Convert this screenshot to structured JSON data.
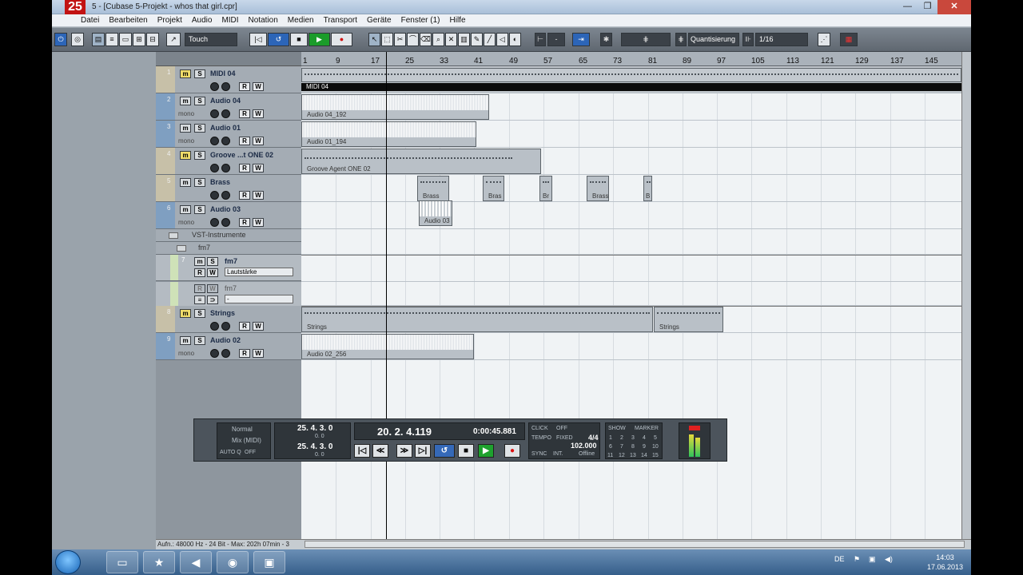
{
  "window": {
    "title": "5 - [Cubase 5-Projekt - whos that girl.cpr]",
    "app_icon_text": "25"
  },
  "menu": [
    "Datei",
    "Bearbeiten",
    "Projekt",
    "Audio",
    "MIDI",
    "Notation",
    "Medien",
    "Transport",
    "Geräte",
    "Fenster (1)",
    "Hilfe"
  ],
  "toolbar": {
    "automation_mode": "Touch",
    "quantize_label": "Quantisierung",
    "quantize_value": "1/16",
    "snap_value": "-"
  },
  "ruler": {
    "ticks": [
      "1",
      "9",
      "17",
      "25",
      "33",
      "41",
      "49",
      "57",
      "65",
      "73",
      "81",
      "89",
      "97",
      "105",
      "113",
      "121",
      "129",
      "137",
      "145"
    ]
  },
  "tracks": [
    {
      "num": "1",
      "name": "MIDI 04",
      "kind": "midi",
      "mono": ""
    },
    {
      "num": "2",
      "name": "Audio 04",
      "kind": "audio",
      "mono": "mono"
    },
    {
      "num": "3",
      "name": "Audio 01",
      "kind": "audio",
      "mono": "mono"
    },
    {
      "num": "4",
      "name": "Groove ...t ONE 02",
      "kind": "midi",
      "mono": ""
    },
    {
      "num": "5",
      "name": "Brass",
      "kind": "midi",
      "mono": ""
    },
    {
      "num": "6",
      "name": "Audio 03",
      "kind": "audio",
      "mono": "mono"
    },
    {
      "num": "8",
      "name": "Strings",
      "kind": "midi",
      "mono": ""
    },
    {
      "num": "9",
      "name": "Audio 02",
      "kind": "audio",
      "mono": "mono"
    }
  ],
  "folders": {
    "vst": "VST-Instrumente",
    "fm7_folder": "fm7"
  },
  "instrument_tracks": [
    {
      "num": "7",
      "name": "fm7",
      "field": "Lautstärke"
    },
    {
      "num": "",
      "name": "fm7",
      "field": "-"
    }
  ],
  "events": {
    "midi04": "MIDI 04",
    "audio04": "Audio 04_192",
    "audio01": "Audio 01_194",
    "groove": "Groove Agent ONE 02",
    "brass1": "Brass",
    "brass2": "Bras",
    "brass3": "Br",
    "brass4": "Brass",
    "brass5": "B",
    "audio03": "Audio 03",
    "strings1": "Strings",
    "strings2": "Strings",
    "audio02": "Audio 02_256"
  },
  "statusbar": "Aufn.: 48000 Hz - 24 Bit - Max: 202h 07min - 3",
  "transport": {
    "sync_mode": "Normal",
    "mix_mode": "Mix (MIDI)",
    "autoq": "AUTO Q",
    "autoq_state": "OFF",
    "left_locator": "25. 4. 3.   0",
    "left_sub": "0.   0",
    "right_locator": "25. 4. 3.   0",
    "right_sub": "0.   0",
    "position": "20.  2.  4.119",
    "time": "0:00:45.881",
    "click_label": "CLICK",
    "click_state": "OFF",
    "tempo_label": "TEMPO",
    "tempo_mode": "FIXED",
    "signature": "4/4",
    "tempo_value": "102.000",
    "sync_label": "SYNC",
    "sync_state": "INT.",
    "offline": "Offline",
    "show_label": "SHOW",
    "marker_label": "MARKER",
    "markers": [
      "1",
      "2",
      "3",
      "4",
      "5",
      "6",
      "7",
      "8",
      "9",
      "10",
      "11",
      "12",
      "13",
      "14",
      "15"
    ]
  },
  "taskbar": {
    "language": "DE",
    "time": "14:03",
    "date": "17.06.2013"
  }
}
